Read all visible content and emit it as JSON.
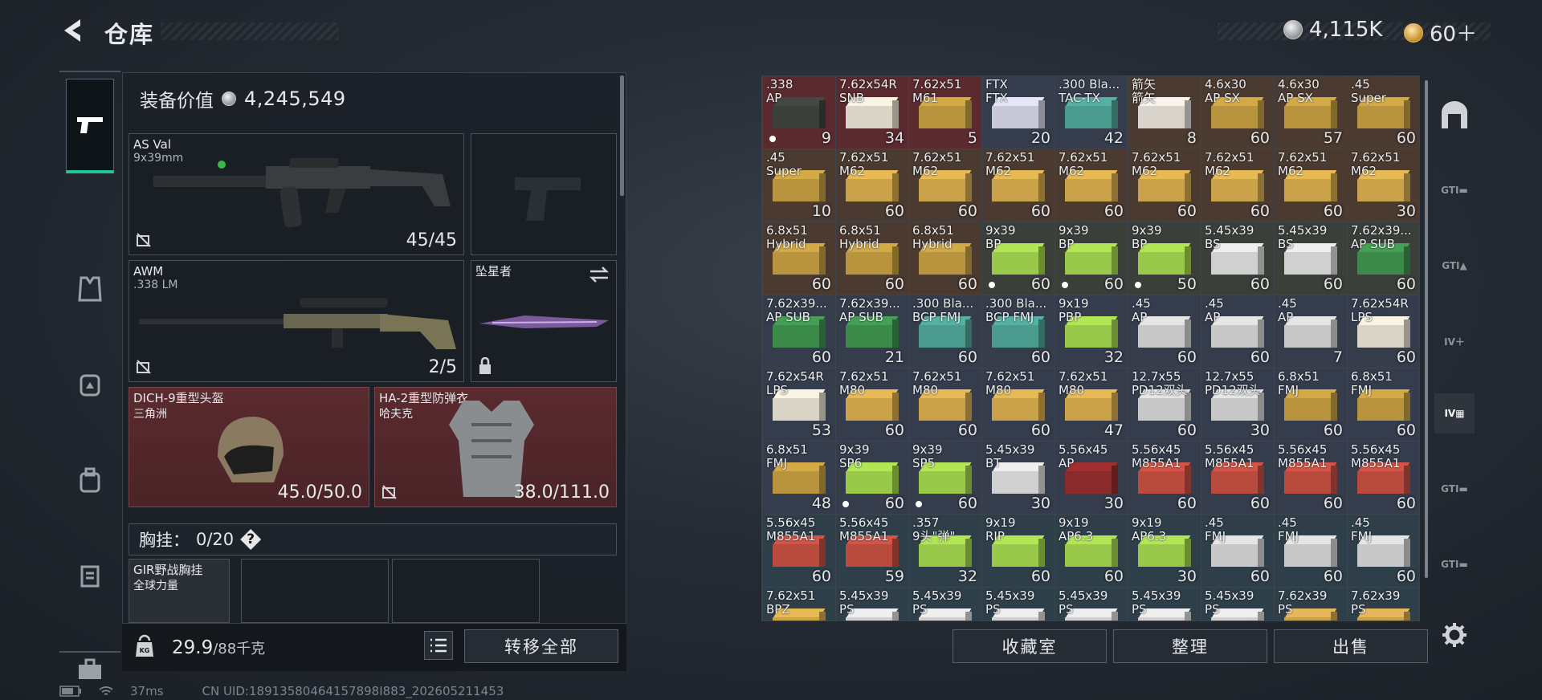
{
  "header": {
    "title": "仓库",
    "currency_silver": "4,115K",
    "currency_gold": "60＋"
  },
  "loadout": {
    "equip_value_label": "装备价值",
    "equip_value": "4,245,549",
    "primary": {
      "name": "AS Val",
      "caliber": "9x39mm",
      "ammo": "45/45"
    },
    "secondary": {
      "name": "AWM",
      "caliber": ".338 LM",
      "ammo": "2/5"
    },
    "melee": {
      "name": "坠星者"
    },
    "helmet": {
      "name": "DICH-9重型头盔",
      "brand": "三角洲",
      "durability": "45.0/50.0"
    },
    "armor": {
      "name": "HA-2重型防弹衣",
      "brand": "哈夫克",
      "durability": "38.0/111.0"
    },
    "chest": {
      "label": "胸挂：",
      "value": "0/20",
      "help": "?"
    },
    "rig": {
      "name": "GIR野战胸挂",
      "brand": "全球力量"
    },
    "weight": "29.9",
    "weight_max": "/88千克",
    "transfer_label": "转移全部"
  },
  "inventory": [
    {
      "n": ".338\nAP",
      "c": "9",
      "col": "#5a2a2e",
      "box": "#3a3f3a",
      "dot": true
    },
    {
      "n": "7.62x54R\nSNB",
      "c": "34",
      "col": "#5a2a2e",
      "box": "#d9d4c5"
    },
    {
      "n": "7.62x51\nM61",
      "c": "5",
      "col": "#5a2a2e",
      "box": "#b8943e"
    },
    {
      "n": "FTX\nFTX",
      "c": "20",
      "col": "#353c4c",
      "box": "#c8c8d8"
    },
    {
      "n": ".300 Bla...\nTAC-TX",
      "c": "42",
      "col": "#353c4c",
      "box": "#4a9a8e"
    },
    {
      "n": "箭矢\n箭矢",
      "c": "8",
      "col": "#4a3a30",
      "box": "#d8d4cc"
    },
    {
      "n": "4.6x30\nAP SX",
      "c": "60",
      "col": "#4a3a30",
      "box": "#b8943e"
    },
    {
      "n": "4.6x30\nAP SX",
      "c": "57",
      "col": "#4a3a30",
      "box": "#b8943e"
    },
    {
      "n": ".45\nSuper",
      "c": "60",
      "col": "#4a3a30",
      "box": "#b8943e"
    },
    {
      "n": ".45\nSuper",
      "c": "10",
      "col": "#4a3a30",
      "box": "#b8943e"
    },
    {
      "n": "7.62x51\nM62",
      "c": "60",
      "col": "#4a3a30",
      "box": "#c9a24a"
    },
    {
      "n": "7.62x51\nM62",
      "c": "60",
      "col": "#4a3a30",
      "box": "#c9a24a"
    },
    {
      "n": "7.62x51\nM62",
      "c": "60",
      "col": "#4a3a30",
      "box": "#c9a24a"
    },
    {
      "n": "7.62x51\nM62",
      "c": "60",
      "col": "#4a3a30",
      "box": "#c9a24a"
    },
    {
      "n": "7.62x51\nM62",
      "c": "60",
      "col": "#4a3a30",
      "box": "#c9a24a"
    },
    {
      "n": "7.62x51\nM62",
      "c": "60",
      "col": "#4a3a30",
      "box": "#c9a24a"
    },
    {
      "n": "7.62x51\nM62",
      "c": "60",
      "col": "#4a3a30",
      "box": "#c9a24a"
    },
    {
      "n": "7.62x51\nM62",
      "c": "30",
      "col": "#4a3a30",
      "box": "#c9a24a"
    },
    {
      "n": "6.8x51\nHybrid",
      "c": "60",
      "col": "#4a3a30",
      "box": "#b8943e"
    },
    {
      "n": "6.8x51\nHybrid",
      "c": "60",
      "col": "#4a3a30",
      "box": "#b8943e"
    },
    {
      "n": "6.8x51\nHybrid",
      "c": "60",
      "col": "#4a3a30",
      "box": "#b8943e"
    },
    {
      "n": "9x39\nBP",
      "c": "60",
      "col": "#3b3f3a",
      "box": "#9ac84a",
      "dot": true
    },
    {
      "n": "9x39\nBP",
      "c": "60",
      "col": "#3b3f3a",
      "box": "#9ac84a",
      "dot": true
    },
    {
      "n": "9x39\nBP",
      "c": "50",
      "col": "#3b3f3a",
      "box": "#9ac84a",
      "dot": true
    },
    {
      "n": "5.45x39\nBS",
      "c": "60",
      "col": "#3b3f3a",
      "box": "#d0d0d0"
    },
    {
      "n": "5.45x39\nBS",
      "c": "60",
      "col": "#3b3f3a",
      "box": "#d0d0d0"
    },
    {
      "n": "7.62x39...\nAP SUB",
      "c": "60",
      "col": "#3b3f3a",
      "box": "#3c8a4a"
    },
    {
      "n": "7.62x39...\nAP SUB",
      "c": "60",
      "col": "#353c4c",
      "box": "#3c8a4a"
    },
    {
      "n": "7.62x39...\nAP SUB",
      "c": "21",
      "col": "#353c4c",
      "box": "#3c8a4a"
    },
    {
      "n": ".300 Bla...\nBCP FMJ",
      "c": "60",
      "col": "#353c4c",
      "box": "#4a9a8e"
    },
    {
      "n": ".300 Bla...\nBCP FMJ",
      "c": "60",
      "col": "#353c4c",
      "box": "#4a9a8e"
    },
    {
      "n": "9x19\nPBP",
      "c": "32",
      "col": "#353c4c",
      "box": "#9ac84a"
    },
    {
      "n": ".45\nAP",
      "c": "60",
      "col": "#353c4c",
      "box": "#c8c8c8"
    },
    {
      "n": ".45\nAP",
      "c": "60",
      "col": "#353c4c",
      "box": "#c8c8c8"
    },
    {
      "n": ".45\nAP",
      "c": "7",
      "col": "#353c4c",
      "box": "#c8c8c8"
    },
    {
      "n": "7.62x54R\nLPS",
      "c": "60",
      "col": "#353c4c",
      "box": "#d9d4c5"
    },
    {
      "n": "7.62x54R\nLPS",
      "c": "53",
      "col": "#353c4c",
      "box": "#d9d4c5"
    },
    {
      "n": "7.62x51\nM80",
      "c": "60",
      "col": "#353c4c",
      "box": "#c9a24a"
    },
    {
      "n": "7.62x51\nM80",
      "c": "60",
      "col": "#353c4c",
      "box": "#c9a24a"
    },
    {
      "n": "7.62x51\nM80",
      "c": "60",
      "col": "#353c4c",
      "box": "#c9a24a"
    },
    {
      "n": "7.62x51\nM80",
      "c": "47",
      "col": "#353c4c",
      "box": "#c9a24a"
    },
    {
      "n": "12.7x55\nPD12双头",
      "c": "60",
      "col": "#353c4c",
      "box": "#c8c8c8"
    },
    {
      "n": "12.7x55\nPD12双头",
      "c": "30",
      "col": "#353c4c",
      "box": "#c8c8c8"
    },
    {
      "n": "6.8x51\nFMJ",
      "c": "60",
      "col": "#353c4c",
      "box": "#b8943e"
    },
    {
      "n": "6.8x51\nFMJ",
      "c": "60",
      "col": "#353c4c",
      "box": "#b8943e"
    },
    {
      "n": "6.8x51\nFMJ",
      "c": "48",
      "col": "#353c4c",
      "box": "#b8943e"
    },
    {
      "n": "9x39\nSP6",
      "c": "60",
      "col": "#353c4c",
      "box": "#9ac84a",
      "dot": true
    },
    {
      "n": "9x39\nSP5",
      "c": "60",
      "col": "#353c4c",
      "box": "#9ac84a",
      "dot": true
    },
    {
      "n": "5.45x39\nBT",
      "c": "30",
      "col": "#353c4c",
      "box": "#d0d0d0"
    },
    {
      "n": "5.56x45\nAP",
      "c": "30",
      "col": "#353c4c",
      "box": "#8a2a2a"
    },
    {
      "n": "5.56x45\nM855A1",
      "c": "60",
      "col": "#353c4c",
      "box": "#b84a3e"
    },
    {
      "n": "5.56x45\nM855A1",
      "c": "60",
      "col": "#353c4c",
      "box": "#b84a3e"
    },
    {
      "n": "5.56x45\nM855A1",
      "c": "60",
      "col": "#353c4c",
      "box": "#b84a3e"
    },
    {
      "n": "5.56x45\nM855A1",
      "c": "60",
      "col": "#353c4c",
      "box": "#b84a3e"
    },
    {
      "n": "5.56x45\nM855A1",
      "c": "60",
      "col": "#2e3f4a",
      "box": "#b84a3e"
    },
    {
      "n": "5.56x45\nM855A1",
      "c": "59",
      "col": "#2e3f4a",
      "box": "#b84a3e"
    },
    {
      "n": ".357\n9头\"弹\"",
      "c": "32",
      "col": "#2e3f4a",
      "box": "#9ac84a"
    },
    {
      "n": "9x19\nRIP",
      "c": "60",
      "col": "#2e3f4a",
      "box": "#9ac84a"
    },
    {
      "n": "9x19\nAP6.3",
      "c": "60",
      "col": "#2e3f4a",
      "box": "#9ac84a"
    },
    {
      "n": "9x19\nAP6.3",
      "c": "30",
      "col": "#2e3f4a",
      "box": "#9ac84a"
    },
    {
      "n": ".45\nFMJ",
      "c": "60",
      "col": "#2e3f4a",
      "box": "#c8c8c8"
    },
    {
      "n": ".45\nFMJ",
      "c": "60",
      "col": "#2e3f4a",
      "box": "#c8c8c8"
    },
    {
      "n": ".45\nFMJ",
      "c": "60",
      "col": "#2e3f4a",
      "box": "#c8c8c8"
    },
    {
      "n": "7.62x51\nBPZ",
      "c": "",
      "col": "#2e3f4a",
      "box": "#c9a24a"
    },
    {
      "n": "5.45x39\nPS",
      "c": "",
      "col": "#2e3f4a",
      "box": "#d0d0d0"
    },
    {
      "n": "5.45x39\nPS",
      "c": "",
      "col": "#2e3f4a",
      "box": "#d0d0d0"
    },
    {
      "n": "5.45x39\nPS",
      "c": "",
      "col": "#2e3f4a",
      "box": "#d0d0d0"
    },
    {
      "n": "5.45x39\nPS",
      "c": "",
      "col": "#2e3f4a",
      "box": "#d0d0d0"
    },
    {
      "n": "5.45x39\nPS",
      "c": "",
      "col": "#2e3f4a",
      "box": "#d0d0d0"
    },
    {
      "n": "5.45x39\nPS",
      "c": "",
      "col": "#2e3f4a",
      "box": "#d0d0d0"
    },
    {
      "n": "7.62x39\nPS",
      "c": "",
      "col": "#2e3f4a",
      "box": "#c8a050"
    },
    {
      "n": "7.62x39\nPS",
      "c": "",
      "col": "#2e3f4a",
      "box": "#c8a050"
    }
  ],
  "actions": {
    "collection": "收藏室",
    "sort": "整理",
    "sell": "出售"
  },
  "status": {
    "ping": "37ms",
    "uid": "CN UID:18913580464157898I883_202605211453"
  }
}
